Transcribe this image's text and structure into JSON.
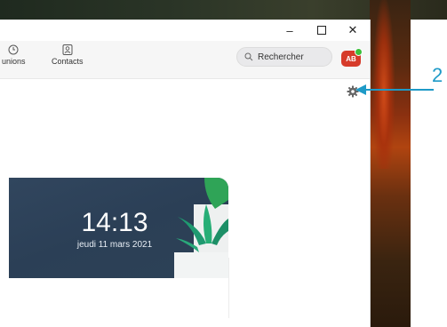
{
  "window": {
    "controls": {
      "minimize": "–",
      "maximize": "☐",
      "close": "✕"
    }
  },
  "toolbar": {
    "nav": [
      {
        "label": "unions",
        "icon": "clock-icon"
      },
      {
        "label": "Contacts",
        "icon": "contact-icon"
      }
    ],
    "search_placeholder": "Rechercher",
    "avatar_initials": "AB",
    "presence_color": "#3bbf3b"
  },
  "callout": {
    "number": "2",
    "color": "#1e9ac7"
  },
  "clock_card": {
    "time": "14:13",
    "date": "jeudi 11 mars 2021"
  }
}
